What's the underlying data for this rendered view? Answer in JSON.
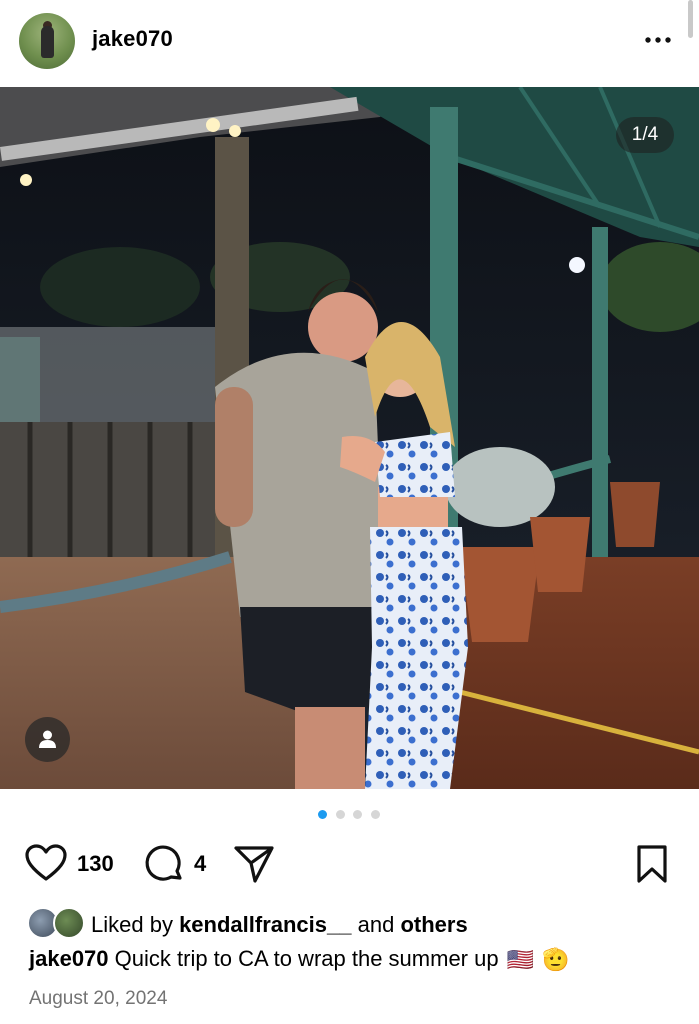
{
  "post": {
    "username": "jake070",
    "counter": "1/4",
    "like_count": "130",
    "comment_count": "4",
    "likes_prefix": "Liked by ",
    "liked_by_user": "kendallfrancis__",
    "likes_and": " and ",
    "likes_others": "others",
    "caption_text": "Quick trip to CA to wrap the summer up",
    "caption_emoji_1": "🇺🇸",
    "caption_emoji_2": "🫡",
    "date": "August 20, 2024",
    "carousel": {
      "total": 4,
      "active": 1
    }
  },
  "icons": {
    "more": "more-horizontal-icon",
    "like": "heart-icon",
    "comment": "comment-bubble-icon",
    "share": "send-icon",
    "save": "bookmark-icon",
    "tag": "person-tag-icon"
  },
  "colors": {
    "accent_dot": "#1d9bf0",
    "text_secondary": "#737373"
  }
}
